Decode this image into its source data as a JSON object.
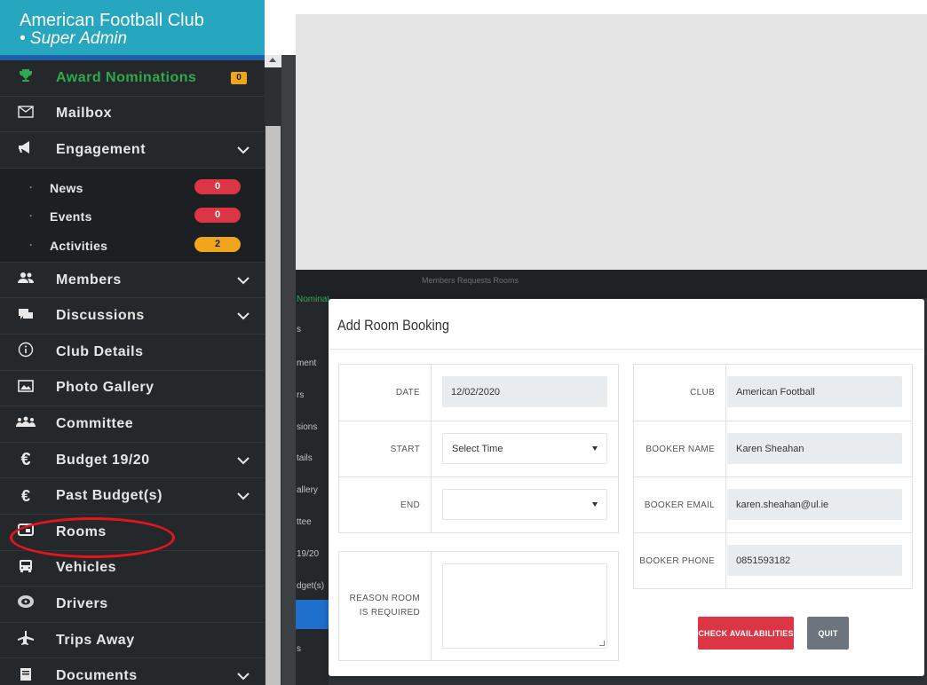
{
  "sidebar": {
    "title": "American Football Club",
    "role": "• Super Admin",
    "award": {
      "label": "Award Nominations",
      "count": "0",
      "icon": "trophy-icon"
    },
    "items": [
      {
        "label": "Mailbox",
        "icon": "envelope-icon"
      },
      {
        "label": "Engagement",
        "icon": "megaphone-icon",
        "expandable": true
      }
    ],
    "engagement_sub": [
      {
        "label": "News",
        "count": "0",
        "color": "#dc3545"
      },
      {
        "label": "Events",
        "count": "0",
        "color": "#dc3545"
      },
      {
        "label": "Activities",
        "count": "2",
        "color": "#f0a51c"
      }
    ],
    "items2": [
      {
        "label": "Members",
        "icon": "users-icon",
        "expandable": true
      },
      {
        "label": "Discussions",
        "icon": "chat-icon",
        "expandable": true
      },
      {
        "label": "Club Details",
        "icon": "info-icon"
      },
      {
        "label": "Photo Gallery",
        "icon": "image-icon"
      },
      {
        "label": "Committee",
        "icon": "group-icon"
      },
      {
        "label": "Budget 19/20",
        "icon": "euro-icon",
        "expandable": true
      },
      {
        "label": "Past Budget(s)",
        "icon": "euro-icon",
        "expandable": true
      },
      {
        "label": "Rooms",
        "icon": "room-icon"
      },
      {
        "label": "Vehicles",
        "icon": "bus-icon"
      },
      {
        "label": "Drivers",
        "icon": "steering-icon"
      },
      {
        "label": "Trips Away",
        "icon": "plane-icon"
      },
      {
        "label": "Documents",
        "icon": "document-icon",
        "expandable": true
      }
    ]
  },
  "background": {
    "topbar_text": "Members   Requests   Rooms",
    "sidebar_fragments": [
      "Nominatio",
      "s",
      "ment",
      "rs",
      "sions",
      "tails",
      "allery",
      "ttee",
      "19/20",
      "dget(s)",
      "s"
    ]
  },
  "modal": {
    "title": "Add Room Booking",
    "left": {
      "date_label": "DATE",
      "date_value": "12/02/2020",
      "start_label": "START",
      "start_value": "Select Time",
      "end_label": "END",
      "end_value": "",
      "reason_label": "REASON ROOM IS REQUIRED",
      "reason_value": ""
    },
    "right": {
      "club_label": "CLUB",
      "club_value": "American Football",
      "booker_name_label": "BOOKER NAME",
      "booker_name_value": "Karen Sheahan",
      "booker_email_label": "BOOKER EMAIL",
      "booker_email_value": "karen.sheahan@ul.ie",
      "booker_phone_label": "BOOKER PHONE",
      "booker_phone_value": "0851593182"
    },
    "buttons": {
      "check": "CHECK AVAILABILITIES",
      "quit": "QUIT"
    }
  },
  "colors": {
    "header": "#26a7bf",
    "sidebar_bg": "#25282a",
    "accent_green": "#2fa84f",
    "danger": "#dc3545",
    "warning": "#f0a51c",
    "secondary": "#6c757d",
    "annotation": "#e8141b"
  }
}
